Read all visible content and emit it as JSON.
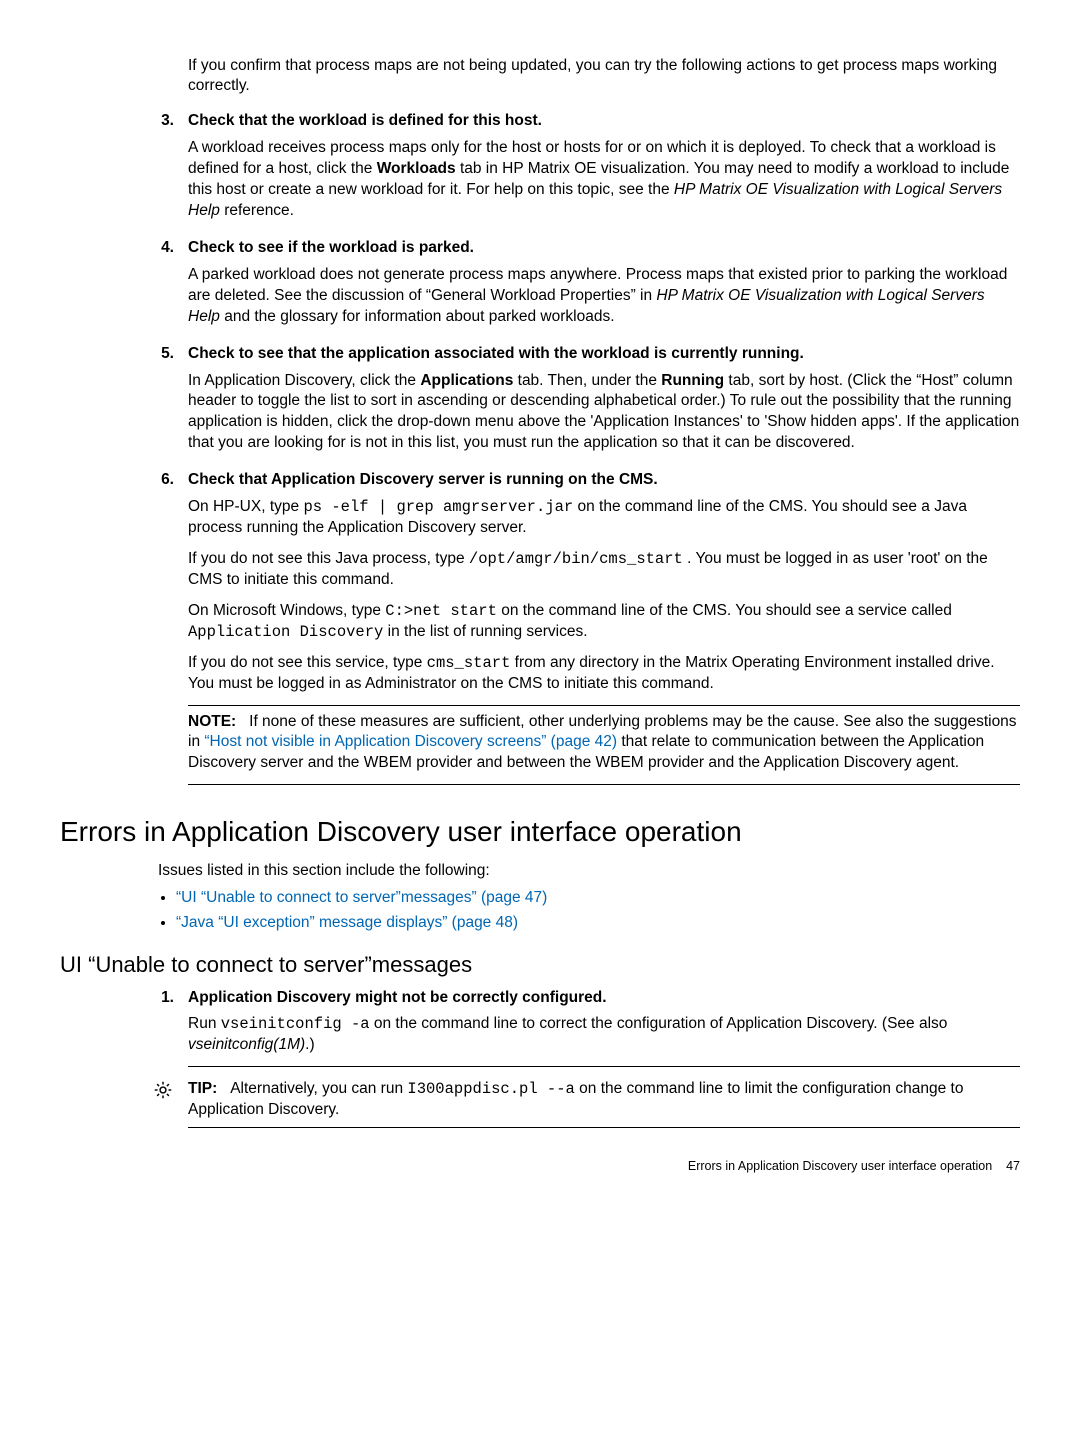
{
  "intro_confirm": "If you confirm that process maps are not being updated, you can try the following actions to get process maps working correctly.",
  "steps": {
    "s3": {
      "num": "3.",
      "head": "Check that the workload is defined for this host.",
      "p1a": "A workload receives process maps only for the host or hosts for or on which it is deployed. To check that a workload is defined for a host, click the ",
      "p1b": "Workloads",
      "p1c": " tab in HP Matrix OE visualization. You may need to modify a workload to include this host or create a new workload for it. For help on this topic, see the ",
      "p1d": "HP Matrix OE Visualization with Logical Servers Help",
      "p1e": " reference."
    },
    "s4": {
      "num": "4.",
      "head": "Check to see if the workload is parked.",
      "p1a": "A parked workload does not generate process maps anywhere. Process maps that existed prior to parking the workload are deleted. See the discussion of “General Workload Properties” in ",
      "p1b": "HP Matrix OE Visualization with Logical Servers Help",
      "p1c": " and the glossary for information about parked workloads."
    },
    "s5": {
      "num": "5.",
      "head": "Check to see that the application associated with the workload is currently running.",
      "p1a": "In Application Discovery, click the ",
      "p1b": "Applications",
      "p1c": " tab. Then, under the ",
      "p1d": "Running",
      "p1e": " tab, sort by host. (Click the “Host” column header to toggle the list to sort in ascending or descending alphabetical order.) To rule out the possibility that the running application is hidden, click the drop-down menu above the 'Application Instances' to 'Show hidden apps'. If the application that you are looking for is not in this list, you must run the application so that it can be discovered."
    },
    "s6": {
      "num": "6.",
      "head": "Check that Application Discovery server is running on the CMS.",
      "p1a": "On HP-UX, type ",
      "p1b": "ps -elf | grep amgrserver.jar",
      "p1c": " on the command line of the CMS. You should see a Java process running the Application Discovery server.",
      "p2a": "If you do not see this Java process, type ",
      "p2b": "/opt/amgr/bin/cms_start",
      "p2c": " . You must be logged in as user 'root' on the CMS to initiate this command.",
      "p3a": "On Microsoft Windows, type ",
      "p3b": "C:>net start",
      "p3c": " on the command line of the CMS. You should see a service called ",
      "p3d": "Application Discovery",
      "p3e": " in the list of running services.",
      "p4a": "If you do not see this service, type ",
      "p4b": "cms_start",
      "p4c": " from any directory in the Matrix Operating Environment installed drive. You must be logged in as Administrator on the CMS to initiate this command.",
      "note_label": "NOTE:",
      "note_a": "If none of these measures are sufficient, other underlying problems may be the cause. See also the suggestions in ",
      "note_link": "“Host not visible in Application Discovery screens” (page 42)",
      "note_b": " that relate to communication between the Application Discovery server and the WBEM provider and between the WBEM provider and the Application Discovery agent."
    }
  },
  "section_title": "Errors in Application Discovery user interface operation",
  "section_intro": "Issues listed in this section include the following:",
  "bullets": {
    "b1": "“UI “Unable to connect to server”messages” (page 47)",
    "b2": "“Java “UI exception” message displays” (page 48)"
  },
  "subsection_title": "UI “Unable to connect to server”messages",
  "sub_steps": {
    "s1": {
      "num": "1.",
      "head": "Application Discovery might not be correctly configured.",
      "p1a": "Run ",
      "p1b": "vseinitconfig -a",
      "p1c": " on the command line to correct the configuration of Application Discovery. (See also ",
      "p1d": "vseinitconfig(1M)",
      "p1e": ".)"
    }
  },
  "tip": {
    "label": "TIP:",
    "a": "Alternatively, you can run ",
    "b": "I300appdisc.pl --a",
    "c": " on the command line to limit the configuration change to Application Discovery."
  },
  "footer": {
    "text": "Errors in Application Discovery user interface operation",
    "page": "47"
  }
}
